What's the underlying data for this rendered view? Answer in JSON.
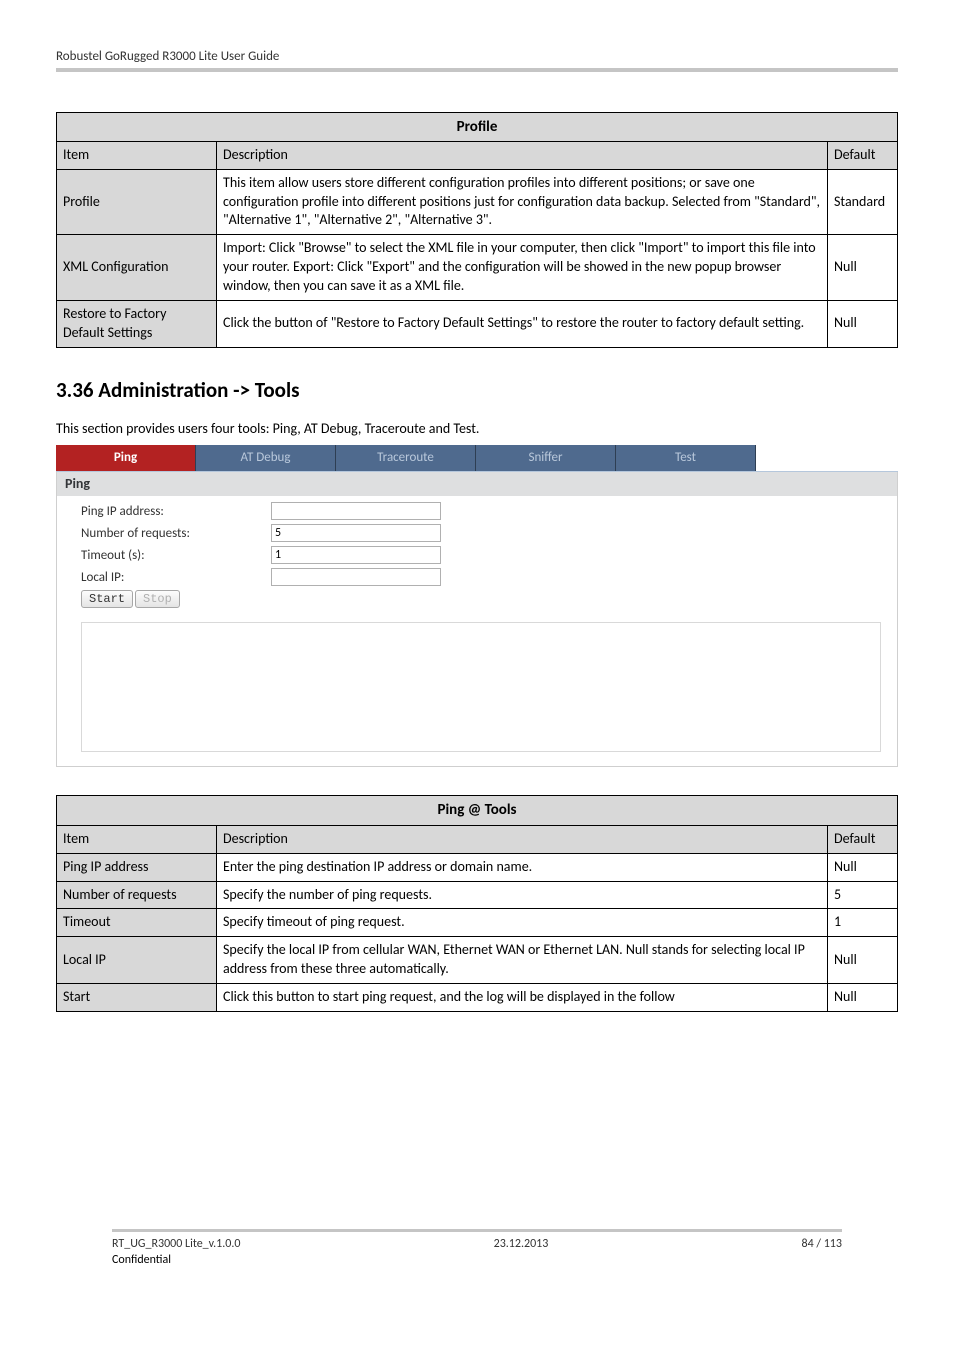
{
  "header": {
    "title": "Robustel GoRugged R3000 Lite User Guide"
  },
  "table1": {
    "title": "Profile",
    "header": {
      "item": "Item",
      "desc": "Description",
      "def": "Default"
    },
    "rows": [
      {
        "item": "Profile",
        "desc": "This item allow users store different configuration profiles into different positions; or save one configuration profile into different positions just for configuration data backup.\nSelected from \"Standard\", \"Alternative 1\", \"Alternative 2\", \"Alternative 3\".",
        "def": "Standard"
      },
      {
        "item": "XML Configuration",
        "desc": "Import: Click \"Browse\" to select the XML file in your computer, then click \"Import\" to import this file into your router.\nExport: Click \"Export\" and the configuration will be showed in the new popup browser window, then you can save it as a XML file.",
        "def": "Null"
      },
      {
        "item": "Restore to Factory Default Settings",
        "desc": "Click the button of \"Restore to Factory Default Settings\" to restore the router to factory default setting.",
        "def": "Null"
      }
    ]
  },
  "section": {
    "heading": "3.36  Administration -> Tools",
    "desc": "This section provides users four tools: Ping, AT Debug, Traceroute and Test."
  },
  "tabs": [
    "Ping",
    "AT Debug",
    "Traceroute",
    "Sniffer",
    "Test"
  ],
  "panel": {
    "title": "Ping",
    "fields": {
      "ping_ip_label": "Ping IP address:",
      "ping_ip_value": "",
      "num_req_label": "Number of requests:",
      "num_req_value": "5",
      "timeout_label": "Timeout (s):",
      "timeout_value": "1",
      "local_ip_label": "Local IP:",
      "local_ip_value": ""
    },
    "buttons": {
      "start": "Start",
      "stop": "Stop"
    }
  },
  "table2": {
    "title": "Ping @ Tools",
    "header": {
      "item": "Item",
      "desc": "Description",
      "def": "Default"
    },
    "rows": [
      {
        "item": "Ping IP address",
        "desc": "Enter the ping destination IP address or domain name.",
        "def": "Null"
      },
      {
        "item": "Number of requests",
        "desc": "Specify the number of ping requests.",
        "def": "5"
      },
      {
        "item": "Timeout",
        "desc": "Specify timeout of ping request.",
        "def": "1"
      },
      {
        "item": "Local IP",
        "desc": "Specify the local IP from cellular WAN, Ethernet WAN or Ethernet LAN. Null stands for selecting local IP address from these three automatically.",
        "def": "Null"
      },
      {
        "item": "Start",
        "desc": "Click this button to start ping request, and the log will be displayed in the follow",
        "def": "Null"
      }
    ]
  },
  "footer": {
    "left": "RT_UG_R3000 Lite_v.1.0.0",
    "center": "23.12.2013",
    "right": "84 / 113",
    "confidential": "Confidential"
  },
  "chart_data": {
    "type": "table",
    "tables": [
      {
        "title": "Profile",
        "columns": [
          "Item",
          "Description",
          "Default"
        ],
        "rows": [
          [
            "Profile",
            "This item allow users store different configuration profiles into different positions; or save one configuration profile into different positions just for configuration data backup. Selected from \"Standard\", \"Alternative 1\", \"Alternative 2\", \"Alternative 3\".",
            "Standard"
          ],
          [
            "XML Configuration",
            "Import: Click \"Browse\" to select the XML file in your computer, then click \"Import\" to import this file into your router. Export: Click \"Export\" and the configuration will be showed in the new popup browser window, then you can save it as a XML file.",
            "Null"
          ],
          [
            "Restore to Factory Default Settings",
            "Click the button of \"Restore to Factory Default Settings\" to restore the router to factory default setting.",
            "Null"
          ]
        ]
      },
      {
        "title": "Ping @ Tools",
        "columns": [
          "Item",
          "Description",
          "Default"
        ],
        "rows": [
          [
            "Ping IP address",
            "Enter the ping destination IP address or domain name.",
            "Null"
          ],
          [
            "Number of requests",
            "Specify the number of ping requests.",
            "5"
          ],
          [
            "Timeout",
            "Specify timeout of ping request.",
            "1"
          ],
          [
            "Local IP",
            "Specify the local IP from cellular WAN, Ethernet WAN or Ethernet LAN. Null stands for selecting local IP address from these three automatically.",
            "Null"
          ],
          [
            "Start",
            "Click this button to start ping request, and the log will be displayed in the follow",
            "Null"
          ]
        ]
      }
    ]
  }
}
